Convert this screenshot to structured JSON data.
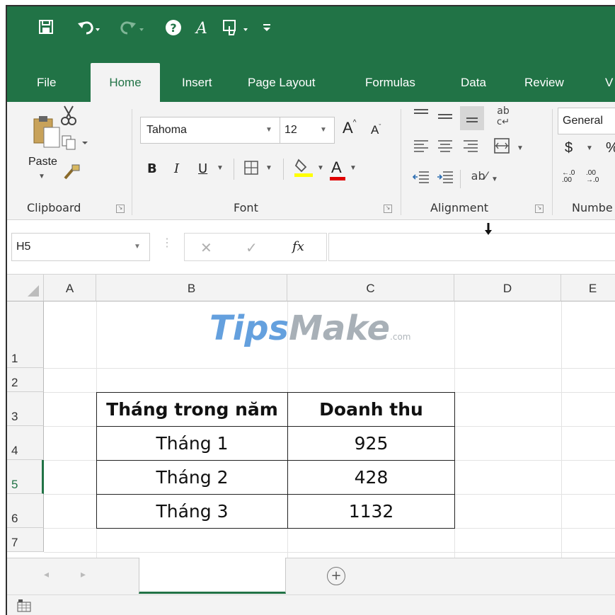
{
  "qat": {
    "save_icon": "save-icon",
    "undo_icon": "undo-icon",
    "redo_icon": "redo-icon",
    "help_icon": "help-icon",
    "format_icon": "text-format-icon",
    "touch_icon": "touch-mode-icon",
    "customize_icon": "customize-qat-icon"
  },
  "tabs": [
    "File",
    "Home",
    "Insert",
    "Page Layout",
    "Formulas",
    "Data",
    "Review",
    "V"
  ],
  "ribbon": {
    "clipboard": {
      "paste_label": "Paste",
      "group_label": "Clipboard"
    },
    "font": {
      "font_name": "Tahoma",
      "font_size": "12",
      "bold": "B",
      "italic": "I",
      "underline": "U",
      "grow": "A",
      "shrink": "A",
      "font_color": "A",
      "group_label": "Font"
    },
    "alignment": {
      "wrap": "ab",
      "group_label": "Alignment"
    },
    "number": {
      "format": "General",
      "currency": "$",
      "percent": "%",
      "inc_decimal": ".00",
      "dec_decimal": ".0",
      "group_label": "Numbe"
    }
  },
  "formula_bar": {
    "name_box": "H5",
    "cancel": "✕",
    "enter": "✓",
    "fx": "fx",
    "formula": ""
  },
  "grid": {
    "columns": [
      "A",
      "B",
      "C",
      "D",
      "E"
    ],
    "rows": [
      "1",
      "2",
      "3",
      "4",
      "5",
      "6",
      "7"
    ],
    "watermark": {
      "tips": "Tips",
      "make": "Make",
      "com": ".com"
    },
    "table": {
      "headers": [
        "Tháng trong năm",
        "Doanh thu"
      ],
      "rows": [
        [
          "Tháng 1",
          "925"
        ],
        [
          "Tháng 2",
          "428"
        ],
        [
          "Tháng 3",
          "1132"
        ]
      ]
    }
  },
  "sheet_bar": {
    "prev": "◂",
    "next": "▸",
    "add_sheet": "+"
  },
  "colors": {
    "excel_green": "#217346",
    "ribbon_bg": "#f3f3f3",
    "watermark_blue": "#4a90d9",
    "watermark_grey": "#9aa3ab"
  }
}
